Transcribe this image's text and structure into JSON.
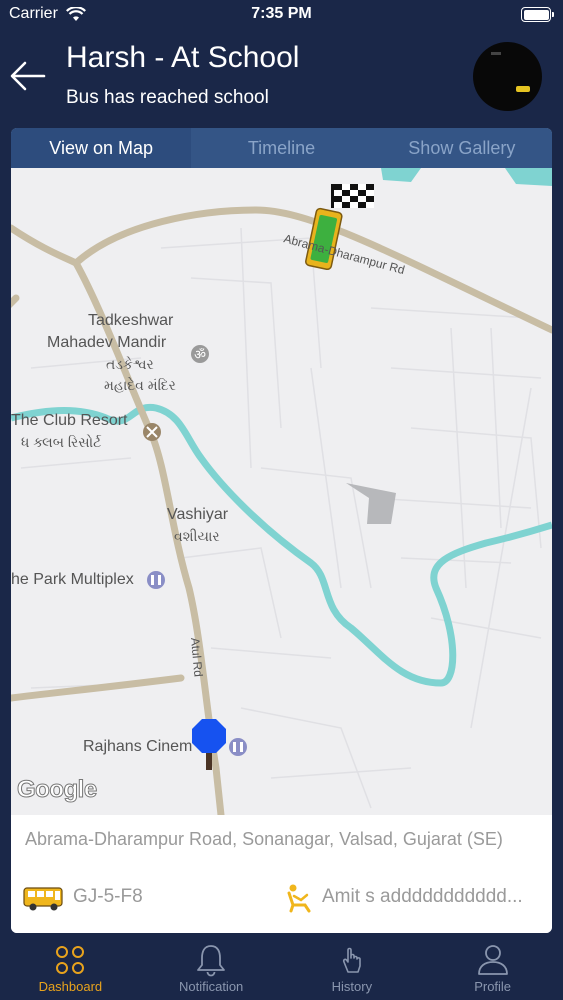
{
  "status_bar": {
    "carrier": "Carrier",
    "time": "7:35 PM"
  },
  "header": {
    "title": "Harsh - At School",
    "subtitle": "Bus has reached school"
  },
  "tabs": [
    {
      "label": "View on Map",
      "active": true
    },
    {
      "label": "Timeline",
      "active": false
    },
    {
      "label": "Show Gallery",
      "active": false
    }
  ],
  "map": {
    "labels": {
      "place1_line1": "Tadkeshwar",
      "place1_line2": "Mahadev Mandir",
      "place1_guj1": "તડકેશ્વર",
      "place1_guj2": "મહાદેવ મંદિર",
      "resort": "The Club Resort",
      "resort_guj": "ધ ક્લબ રિસોર્ટ",
      "village": "Vashiyar",
      "village_guj": "વશીયાર",
      "multiplex": "he Park Multiplex",
      "cinema": "Rajhans Cinem",
      "road1": "Abrama-Dharampur Rd",
      "road2": "Atul Rd"
    },
    "attribution": "Google"
  },
  "trip": {
    "address": "Abrama-Dharampur Road, Sonanagar, Valsad, Gujarat (SE)",
    "vehicle": "GJ-5-F8",
    "driver": "Amit s addddddddddd..."
  },
  "tabbar": [
    {
      "label": "Dashboard",
      "icon": "dashboard-icon",
      "active": true
    },
    {
      "label": "Notification",
      "icon": "bell-icon",
      "active": false
    },
    {
      "label": "History",
      "icon": "history-icon",
      "active": false
    },
    {
      "label": "Profile",
      "icon": "profile-icon",
      "active": false
    }
  ],
  "colors": {
    "background": "#1a2748",
    "accent": "#e8a31d",
    "river": "#7fd3d1",
    "road": "#c8bda4"
  }
}
